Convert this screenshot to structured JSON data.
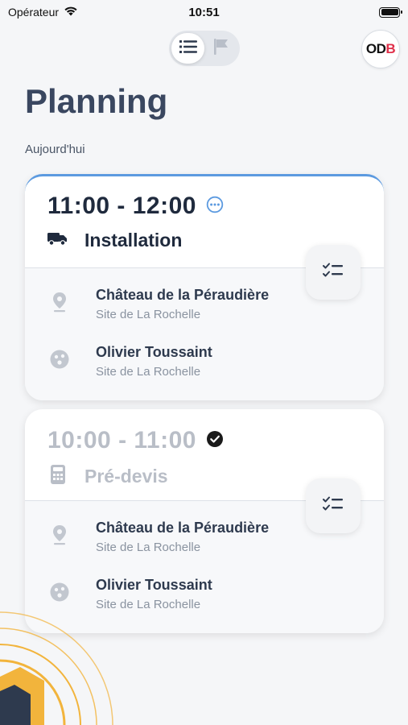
{
  "status_bar": {
    "carrier": "Opérateur",
    "time": "10:51"
  },
  "header": {
    "avatar_text_main": "OD",
    "avatar_text_accent": "B"
  },
  "page": {
    "title": "Planning",
    "section_label": "Aujourd'hui"
  },
  "appointments": [
    {
      "time": "11:00 - 12:00",
      "type": "Installation",
      "status_icon": "more-icon",
      "type_icon": "truck-icon",
      "location_name": "Château de la Péraudière",
      "location_site": "Site de La Rochelle",
      "person_name": "Olivier Toussaint",
      "person_site": "Site de La Rochelle"
    },
    {
      "time": "10:00 - 11:00",
      "type": "Pré-devis",
      "status_icon": "check-circle-icon",
      "type_icon": "calculator-icon",
      "location_name": "Château de la Péraudière",
      "location_site": "Site de La Rochelle",
      "person_name": "Olivier Toussaint",
      "person_site": "Site de La Rochelle"
    }
  ],
  "colors": {
    "accent_blue": "#5c9ae0",
    "title": "#3a4760",
    "decor_orange": "#f2b43c"
  }
}
